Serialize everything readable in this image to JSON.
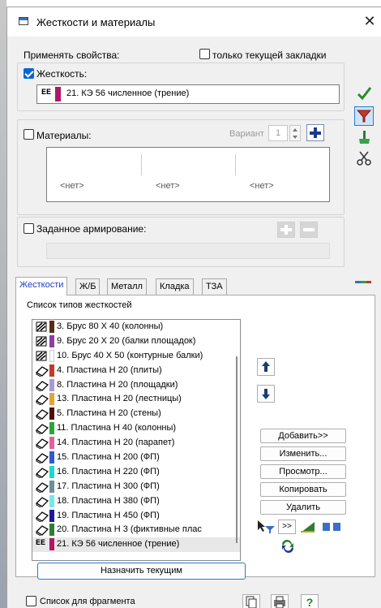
{
  "window": {
    "title": "Жесткости и материалы",
    "close_glyph": "✕"
  },
  "apply": {
    "label": "Применять свойства:",
    "only_current_tab": {
      "label": "только текущей закладки",
      "checked": false
    }
  },
  "stiffness": {
    "label": "Жесткость:",
    "checked": true,
    "badge": "EE",
    "color": "#b01863",
    "value": "21. КЭ 56 численное (трение)"
  },
  "materials": {
    "label": "Материалы:",
    "checked": false,
    "variant_label": "Вариант",
    "variant_value": "1",
    "cells": [
      "<нет>",
      "<нет>",
      "<нет>"
    ]
  },
  "reinforcement": {
    "label": "Заданное армирование:",
    "checked": false
  },
  "tabs": [
    "Жесткости",
    "Ж/Б",
    "Металл",
    "Кладка",
    "ТЗА"
  ],
  "list": {
    "title": "Список типов жесткостей",
    "items": [
      {
        "text": "3. Брус 80 X 40 (колонны)",
        "icon": "beam-icon",
        "color": "#5a2d0c"
      },
      {
        "text": "9. Брус 20 X 20 (балки площадок)",
        "icon": "beam-icon",
        "color": "#8b3fa1"
      },
      {
        "text": "10. Брус 40 X 50 (контурные балки)",
        "icon": "beam-icon",
        "color": "#ffffff"
      },
      {
        "text": "4. Пластина  H 20 (плиты)",
        "icon": "plate-icon",
        "color": "#c33a2a"
      },
      {
        "text": "8. Пластина  H 20 (площадки)",
        "icon": "plate-icon",
        "color": "#a79ad6"
      },
      {
        "text": "13. Пластина  H 20 (лестницы)",
        "icon": "plate-icon",
        "color": "#e4a23a"
      },
      {
        "text": "5. Пластина  H 20 (стены)",
        "icon": "plate-icon",
        "color": "#4a1212"
      },
      {
        "text": "11. Пластина  H 40 (колонны)",
        "icon": "plate-icon",
        "color": "#2aa638"
      },
      {
        "text": "14. Пластина  H 20 (парапет)",
        "icon": "plate-icon",
        "color": "#e25fa0"
      },
      {
        "text": "15. Пластина  H 200 (ФП)",
        "icon": "plate-icon",
        "color": "#2f57d6"
      },
      {
        "text": "16. Пластина  H 220 (ФП)",
        "icon": "plate-icon",
        "color": "#18d8d0"
      },
      {
        "text": "17. Пластина  H 300 (ФП)",
        "icon": "plate-icon",
        "color": "#6e8f9a"
      },
      {
        "text": "18. Пластина  H 380 (ФП)",
        "icon": "plate-icon",
        "color": "#77e8e8"
      },
      {
        "text": "19. Пластина  H 450 (ФП)",
        "icon": "plate-icon",
        "color": "#1a1aa0"
      },
      {
        "text": "20. Пластина  H 3 (фиктивные плас",
        "icon": "plate-icon",
        "color": "#2e7d32"
      },
      {
        "text": "21. КЭ 56 численное (трение)",
        "icon": "ee-icon",
        "color": "#b01863",
        "badge": "EE"
      }
    ]
  },
  "actions": {
    "add": "Добавить>>",
    "edit": "Изменить...",
    "view": "Просмотр...",
    "copy": "Копировать",
    "delete": "Удалить",
    "more": ">>"
  },
  "assign_current": "Назначить текущим",
  "fragment_list": {
    "label": "Список для фрагмента",
    "checked": false
  },
  "bottom_help": "?"
}
